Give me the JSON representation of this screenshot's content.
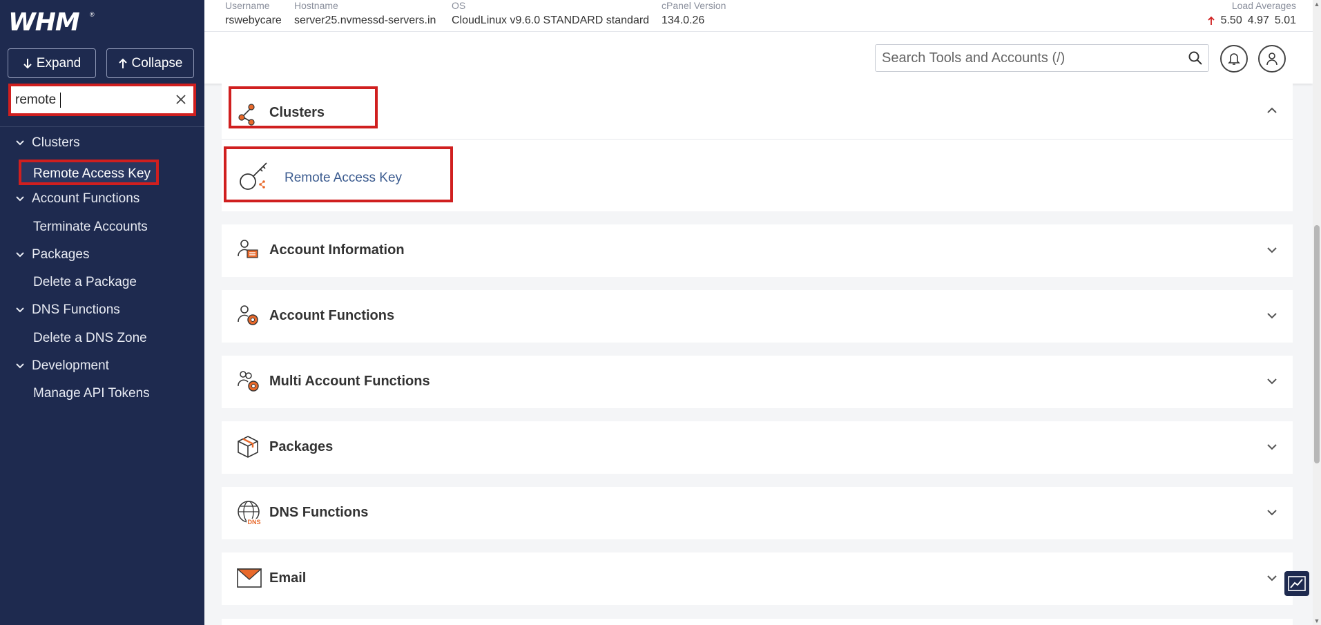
{
  "sidebar": {
    "logo": "WHM",
    "logo_mark": "®",
    "expand_label": "Expand",
    "collapse_label": "Collapse",
    "search_value": "remote",
    "categories": [
      {
        "label": "Clusters",
        "items": [
          "Remote Access Key"
        ]
      },
      {
        "label": "Account Functions",
        "items": [
          "Terminate Accounts"
        ]
      },
      {
        "label": "Packages",
        "items": [
          "Delete a Package"
        ]
      },
      {
        "label": "DNS Functions",
        "items": [
          "Delete a DNS Zone"
        ]
      },
      {
        "label": "Development",
        "items": [
          "Manage API Tokens"
        ]
      }
    ]
  },
  "topbar": {
    "username_label": "Username",
    "username": "rswebycare",
    "hostname_label": "Hostname",
    "hostname": "server25.nvmessd-servers.in",
    "os_label": "OS",
    "os": "CloudLinux v9.6.0 STANDARD standard",
    "cpanel_label": "cPanel Version",
    "cpanel": "134.0.26",
    "load_label": "Load Averages",
    "load": [
      "5.50",
      "4.97",
      "5.01"
    ]
  },
  "header": {
    "search_placeholder": "Search Tools and Accounts (/)"
  },
  "sections": [
    {
      "title": "Clusters",
      "expanded": true,
      "tools": [
        "Remote Access Key"
      ]
    },
    {
      "title": "Account Information",
      "expanded": false
    },
    {
      "title": "Account Functions",
      "expanded": false
    },
    {
      "title": "Multi Account Functions",
      "expanded": false
    },
    {
      "title": "Packages",
      "expanded": false
    },
    {
      "title": "DNS Functions",
      "expanded": false
    },
    {
      "title": "Email",
      "expanded": false
    }
  ],
  "colors": {
    "sidebar_bg": "#1e2a4f",
    "highlight": "#d01f1f",
    "icon_orange": "#e8692b",
    "link": "#3b5b8f"
  }
}
